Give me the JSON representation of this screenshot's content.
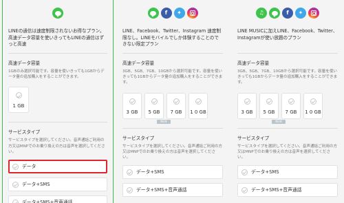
{
  "plans": [
    {
      "icons": [
        "line-icon"
      ],
      "description": "LINEの通信は速度制限されないお得なプラン。高速データ容量を使いきってもLINEの通信はずっと高速",
      "capacity_title": "高速データ容量",
      "capacity_sub": "1GBのみ選択可能です。容量を使いきっても1GBからデータ量の追加購入をすることができます。",
      "capacities": [
        "1 GB"
      ],
      "service_title": "サービスタイプ",
      "service_sub": "サービスタイプを選択してください。音声通話ご利用の方又はMNPでのお乗り換えの方は音声を選択してください。",
      "services": [
        "データ",
        "データ+SMS",
        "データ+SMS+音声通話"
      ],
      "selected_service": 0
    },
    {
      "icons": [
        "line-icon",
        "facebook-icon",
        "twitter-icon",
        "instagram-icon"
      ],
      "description": "LINE、Facebook、Twitter、Instagram 速度制限なし。LINEモバイルでしか体験することのできない限定プラン",
      "capacity_title": "高速データ容量",
      "capacity_sub": "3GB、5GB、7GB、10GBから選択可能です。容量を使いきっても1GBからデータ量の追加購入をすることができます。",
      "capacities": [
        "3 GB",
        "5 GB",
        "7 GB",
        "1 0 GB"
      ],
      "badge": "NEW",
      "service_title": "サービスタイプ",
      "service_sub": "サービスタイプを選択してください。音声通話ご利用の方又はMNPでのお乗り換えの方は音声を選択してください。",
      "services": [
        "データ+SMS",
        "データ+SMS+音声通話"
      ]
    },
    {
      "icons": [
        "line-music-icon",
        "line-icon",
        "facebook-icon",
        "twitter-icon",
        "instagram-icon"
      ],
      "description": "LINE MUSICに加えLINE、Facebook、Twitter、Instagramが使い放題のプラン",
      "capacity_title": "高速データ容量",
      "capacity_sub": "3GB、5GB、7GB、10GBから選択可能です。容量を使いきっても1GBからデータ量の追加購入をすることができます。",
      "capacities": [
        "3 GB",
        "5 GB",
        "7 GB",
        "1 0 GB"
      ],
      "badge": "NEW",
      "service_title": "サービスタイプ",
      "service_sub": "サービスタイプを選択してください。音声通話ご利用の方又はMNPでのお乗り換えの方は音声を選択してください。",
      "services": [
        "データ+SMS",
        "データ+SMS+音声通話"
      ]
    }
  ],
  "colors": {
    "accent_green": "#3fbe4e",
    "selected_red": "#e0242f",
    "facebook": "#3b5ca8",
    "twitter": "#3fa8e8"
  }
}
